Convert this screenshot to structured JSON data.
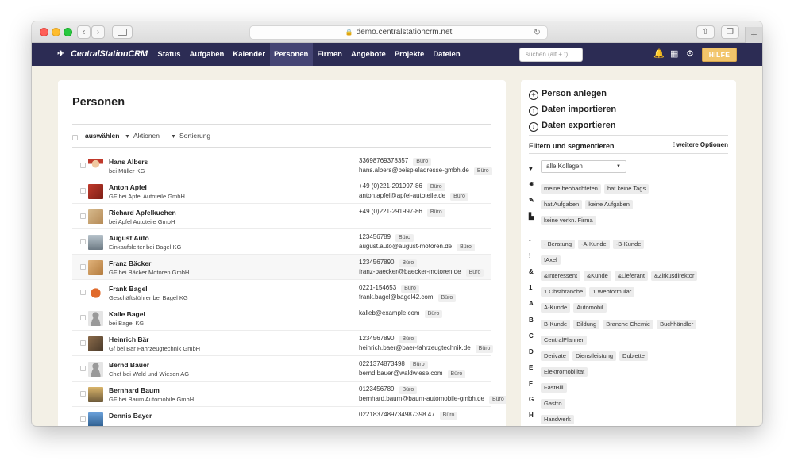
{
  "browser": {
    "url": "demo.centralstationcrm.net"
  },
  "app": {
    "logo": "CentralStationCRM",
    "nav": [
      "Status",
      "Aufgaben",
      "Kalender",
      "Personen",
      "Firmen",
      "Angebote",
      "Projekte",
      "Dateien"
    ],
    "active_nav": "Personen",
    "search_placeholder": "suchen (alt + f)",
    "help_label": "HILFE"
  },
  "main": {
    "title": "Personen",
    "toolbar": {
      "select_label": "auswählen",
      "actions_label": "Aktionen",
      "sort_label": "Sortierung"
    },
    "people": [
      {
        "name": "Hans Albers",
        "role": "bei ",
        "company": "Müller KG",
        "phone": "33698769378357",
        "phone_tag": "Büro",
        "email": "hans.albers@beispieladresse-gmbh.de",
        "email_tag": "Büro"
      },
      {
        "name": "Anton Apfel",
        "role": "GF bei ",
        "company": "Apfel Autoteile GmbH",
        "phone": "+49 (0)221-291997-86",
        "phone_tag": "Büro",
        "email": "anton.apfel@apfel-autoteile.de",
        "email_tag": "Büro"
      },
      {
        "name": "Richard Apfelkuchen",
        "role": "bei ",
        "company": "Apfel Autoteile GmbH",
        "phone": "+49 (0)221-291997-86",
        "phone_tag": "Büro",
        "email": "",
        "email_tag": ""
      },
      {
        "name": "August Auto",
        "role": "Einkaufsleiter bei ",
        "company": "Bagel KG",
        "phone": "123456789",
        "phone_tag": "Büro",
        "email": "august.auto@august-motoren.de",
        "email_tag": "Büro"
      },
      {
        "name": "Franz Bäcker",
        "role": "GF bei ",
        "company": "Bäcker Motoren GmbH",
        "phone": "1234567890",
        "phone_tag": "Büro",
        "email": "franz-baecker@baecker-motoren.de",
        "email_tag": "Büro"
      },
      {
        "name": "Frank Bagel",
        "role": "Geschäftsführer bei ",
        "company": "Bagel KG",
        "phone": "0221-154653",
        "phone_tag": "Büro",
        "email": "frank.bagel@bagel42.com",
        "email_tag": "Büro"
      },
      {
        "name": "Kalle Bagel",
        "role": "bei ",
        "company": "Bagel KG",
        "phone": "",
        "phone_tag": "",
        "email": "kalleb@example.com",
        "email_tag": "Büro"
      },
      {
        "name": "Heinrich Bär",
        "role": "Gf bei ",
        "company": "Bär Fahrzeugtechnik GmbH",
        "phone": "1234567890",
        "phone_tag": "Büro",
        "email": "heinrich.baer@baer-fahrzeugtechnik.de",
        "email_tag": "Büro"
      },
      {
        "name": "Bernd Bauer",
        "role": "Chef bei ",
        "company": "Wald und Wiesen AG",
        "phone": "0221374873498",
        "phone_tag": "Büro",
        "email": "bernd.bauer@waldwiese.com",
        "email_tag": "Büro"
      },
      {
        "name": "Bernhard Baum",
        "role": "GF bei ",
        "company": "Baum Automobile GmbH",
        "phone": "0123456789",
        "phone_tag": "Büro",
        "email": "bernhard.baum@baum-automobile-gmbh.de",
        "email_tag": "Büro"
      },
      {
        "name": "Dennis Bayer",
        "role": "",
        "company": "",
        "phone": "0221837489734987398 47",
        "phone_tag": "Büro",
        "email": "",
        "email_tag": ""
      }
    ]
  },
  "sidebar": {
    "actions": [
      "Person anlegen",
      "Daten importieren",
      "Daten exportieren"
    ],
    "filter_title": "Filtern und segmentieren",
    "more_options": "weitere Optionen",
    "colleague_select": "alle Kollegen",
    "filters": [
      {
        "label": "♥",
        "tags": []
      },
      {
        "label": "✷",
        "tags": [
          "meine beobachteten",
          "hat keine Tags"
        ]
      },
      {
        "label": "✎",
        "tags": [
          "hat Aufgaben",
          "keine Aufgaben"
        ]
      },
      {
        "label": "▙",
        "tags": [
          "keine verkn. Firma"
        ]
      }
    ],
    "tag_groups": [
      {
        "label": "-",
        "tags": [
          "- Beratung",
          "-A-Kunde",
          "-B-Kunde"
        ]
      },
      {
        "label": "!",
        "tags": [
          "!Axel"
        ]
      },
      {
        "label": "&",
        "tags": [
          "&Interessent",
          "&Kunde",
          "&Lieferant",
          "&Zirkusdirektor"
        ]
      },
      {
        "label": "1",
        "tags": [
          "1 Obstbranche",
          "1 Webformular"
        ]
      },
      {
        "label": "A",
        "tags": [
          "A-Kunde",
          "Automobil"
        ]
      },
      {
        "label": "B",
        "tags": [
          "B-Kunde",
          "Bildung",
          "Branche Chemie",
          "Buchhändler"
        ]
      },
      {
        "label": "C",
        "tags": [
          "CentralPlanner"
        ]
      },
      {
        "label": "D",
        "tags": [
          "Derivate",
          "Dienstleistung",
          "Dublette"
        ]
      },
      {
        "label": "E",
        "tags": [
          "Elektromobilität"
        ]
      },
      {
        "label": "F",
        "tags": [
          "FastBill"
        ]
      },
      {
        "label": "G",
        "tags": [
          "Gastro"
        ]
      },
      {
        "label": "H",
        "tags": [
          "Handwerk"
        ]
      }
    ]
  }
}
